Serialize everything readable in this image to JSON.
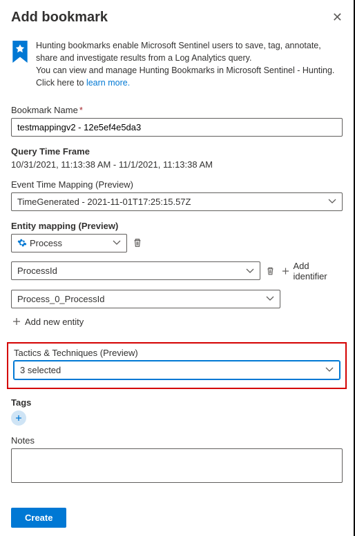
{
  "header": {
    "title": "Add bookmark"
  },
  "info": {
    "line1": "Hunting bookmarks enable Microsoft Sentinel users to save, tag, annotate, share and investigate results from a Log Analytics query.",
    "line2": "You can view and manage Hunting Bookmarks in Microsoft Sentinel - Hunting.",
    "line3_prefix": "Click here to ",
    "learn_more": "learn more."
  },
  "bookmark_name": {
    "label": "Bookmark Name",
    "value": "testmappingv2 - 12e5ef4e5da3"
  },
  "query_time": {
    "label": "Query Time Frame",
    "value": "10/31/2021, 11:13:38 AM - 11/1/2021, 11:13:38 AM"
  },
  "event_time": {
    "label": "Event Time Mapping (Preview)",
    "value": "TimeGenerated - 2021-11-01T17:25:15.57Z"
  },
  "entity_mapping": {
    "label": "Entity mapping (Preview)",
    "type_value": "Process",
    "id_field_value": "ProcessId",
    "column_value": "Process_0_ProcessId",
    "add_identifier": "Add identifier",
    "add_new_entity": "Add new entity"
  },
  "tactics": {
    "label": "Tactics & Techniques (Preview)",
    "value": "3 selected"
  },
  "tags": {
    "label": "Tags"
  },
  "notes": {
    "label": "Notes"
  },
  "footer": {
    "create": "Create"
  }
}
